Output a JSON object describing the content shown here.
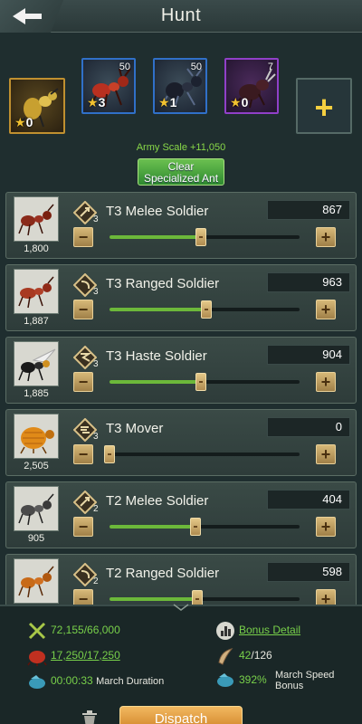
{
  "header": {
    "title": "Hunt"
  },
  "specialized_ants": [
    {
      "icon": "golden-ant-icon",
      "count": "",
      "stars": "0",
      "border": "#c09030"
    },
    {
      "icon": "red-ant-icon",
      "count": "50",
      "stars": "3",
      "border": "#3070c8"
    },
    {
      "icon": "black-ant-icon",
      "count": "50",
      "stars": "1",
      "border": "#3070c8"
    },
    {
      "icon": "beetle-icon",
      "count": "7",
      "stars": "0",
      "border": "#9040c8"
    }
  ],
  "add_button": {
    "label": "+"
  },
  "army_scale": "Army Scale +11,050",
  "clear_button": {
    "line1": "Clear",
    "line2": "Specialized Ant"
  },
  "soldiers": [
    {
      "name": "T3 Melee Soldier",
      "tier": "3",
      "available": "1,800",
      "quantity": "867",
      "fraction": 0.48,
      "type_icon": "melee-icon"
    },
    {
      "name": "T3 Ranged Soldier",
      "tier": "3",
      "available": "1,887",
      "quantity": "963",
      "fraction": 0.51,
      "type_icon": "ranged-icon"
    },
    {
      "name": "T3 Haste Soldier",
      "tier": "3",
      "available": "1,885",
      "quantity": "904",
      "fraction": 0.48,
      "type_icon": "haste-icon"
    },
    {
      "name": "T3 Mover",
      "tier": "3",
      "available": "2,505",
      "quantity": "0",
      "fraction": 0.0,
      "type_icon": "mover-icon"
    },
    {
      "name": "T2 Melee Soldier",
      "tier": "2",
      "available": "905",
      "quantity": "404",
      "fraction": 0.45,
      "type_icon": "melee-icon"
    },
    {
      "name": "T2 Ranged Soldier",
      "tier": "2",
      "available": "",
      "quantity": "598",
      "fraction": 0.46,
      "type_icon": "ranged-icon"
    }
  ],
  "footer": {
    "power": "72,155/66,000",
    "bonus_detail": "Bonus Detail",
    "load": "17,250/17,250",
    "march_slots_used": "42",
    "march_slots_total": "/126",
    "march_duration_value": "00:00:33",
    "march_duration_label": "March Duration",
    "march_speed_value": "392%",
    "march_speed_label_1": "March Speed",
    "march_speed_label_2": "Bonus",
    "dispatch_label": "Dispatch"
  },
  "colors": {
    "accent_green": "#78d04a",
    "button_gold": "#d6b878",
    "dispatch_orange": "#e09a3a"
  }
}
